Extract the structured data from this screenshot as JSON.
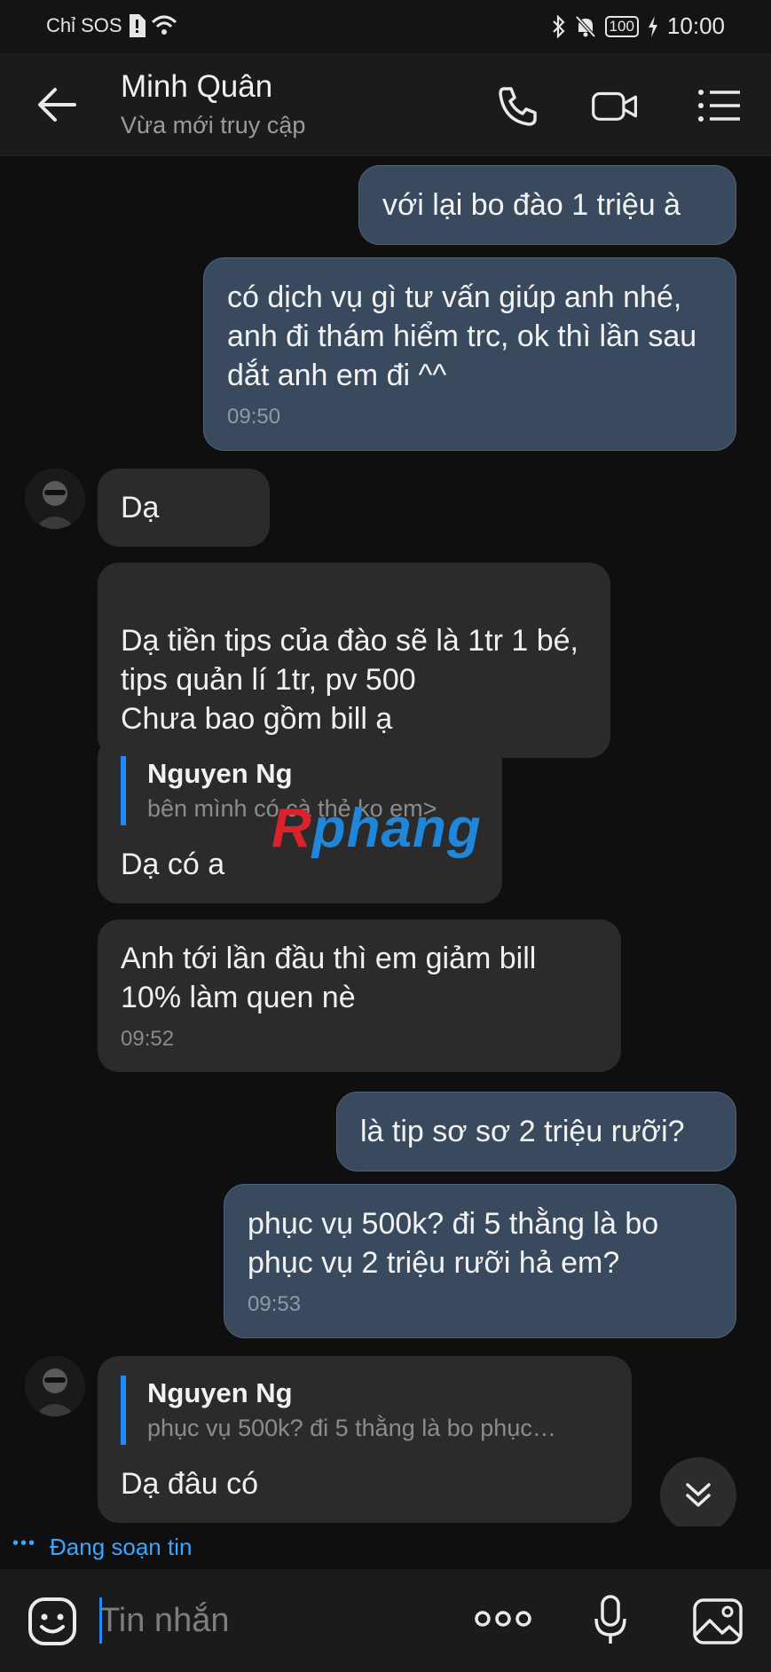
{
  "status_bar": {
    "carrier": "Chỉ SOS",
    "battery": "100",
    "time": "10:00"
  },
  "header": {
    "contact_name": "Minh Quân",
    "contact_status": "Vừa mới truy cập"
  },
  "messages": [
    {
      "dir": "out",
      "text": "với lại bo đào 1 triệu à",
      "time": ""
    },
    {
      "dir": "out",
      "text": "có dịch vụ gì tư vấn giúp anh nhé, anh đi thám hiểm trc, ok thì lần sau dắt anh em đi ^^",
      "time": "09:50"
    },
    {
      "dir": "in",
      "text": "Dạ",
      "time": ""
    },
    {
      "dir": "in",
      "text": "Dạ tiền tips của đào sẽ là 1tr 1 bé, tips quản lí 1tr, pv 500\nChưa bao gồm bill ạ",
      "time": ""
    },
    {
      "dir": "in",
      "quote_name": "Nguyen Ng",
      "quote_text": "bên mình có cà thẻ ko em>",
      "text": "Dạ có a",
      "time": ""
    },
    {
      "dir": "in",
      "text": "Anh tới lần đầu thì em giảm bill 10% làm quen nè",
      "time": "09:52"
    },
    {
      "dir": "out",
      "text": "là tip sơ sơ 2 triệu rưỡi?",
      "time": ""
    },
    {
      "dir": "out",
      "text": "phục vụ 500k? đi 5 thằng là bo phục vụ 2 triệu rưỡi hả em?",
      "time": "09:53"
    },
    {
      "dir": "in",
      "quote_name": "Nguyen Ng",
      "quote_text": "phục vụ 500k? đi 5 thằng là bo phục…",
      "text": "Dạ đâu có",
      "time": ""
    }
  ],
  "watermark": {
    "part1": "R",
    "part2": "phang"
  },
  "typing_indicator": "Đang soạn tin",
  "composer": {
    "placeholder": "Tin nhắn"
  },
  "colors": {
    "outgoing_bubble": "#3a4a5e",
    "incoming_bubble": "#2b2b2c",
    "accent": "#1f8bff"
  },
  "icons": [
    "back-arrow-icon",
    "phone-icon",
    "video-call-icon",
    "menu-list-icon",
    "scroll-down-icon",
    "sticker-icon",
    "more-icon",
    "microphone-icon",
    "image-icon"
  ]
}
